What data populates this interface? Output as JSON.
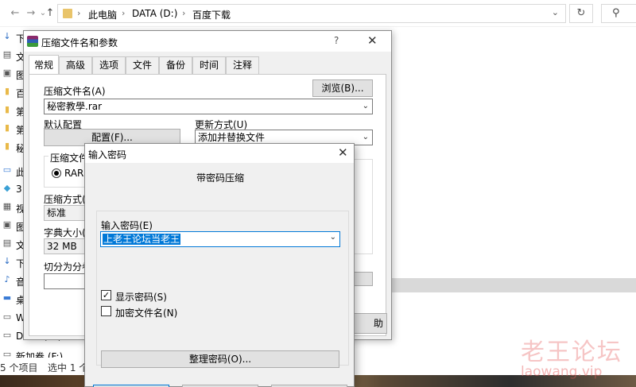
{
  "explorer": {
    "breadcrumb": [
      "此电脑",
      "DATA (D:)",
      "百度下载"
    ],
    "nav": {
      "back": "←",
      "forward": "→",
      "recent": "⌄",
      "up": "↑"
    },
    "refresh_icon": "↻",
    "search_icon": "⚲",
    "sidebar_items": [
      {
        "icon": "↓",
        "text": "下",
        "color": "#2b6cc4"
      },
      {
        "icon": "▤",
        "text": "文",
        "color": "#555"
      },
      {
        "icon": "▣",
        "text": "图",
        "color": "#555"
      },
      {
        "icon": "▮",
        "text": "百",
        "color": "#e9b949"
      },
      {
        "icon": "▮",
        "text": "第",
        "color": "#e9b949"
      },
      {
        "icon": "▮",
        "text": "第",
        "color": "#e9b949"
      },
      {
        "icon": "▮",
        "text": "秘",
        "color": "#e9b949"
      },
      {
        "icon": "▭",
        "text": "此",
        "color": "#3a7bd5"
      },
      {
        "icon": "◆",
        "text": "3",
        "color": "#3aa0d5"
      },
      {
        "icon": "▦",
        "text": "视",
        "color": "#555"
      },
      {
        "icon": "▣",
        "text": "图",
        "color": "#555"
      },
      {
        "icon": "▤",
        "text": "文",
        "color": "#555"
      },
      {
        "icon": "↓",
        "text": "下",
        "color": "#2b6cc4"
      },
      {
        "icon": "♪",
        "text": "音",
        "color": "#2b6cc4"
      },
      {
        "icon": "▬",
        "text": "桌",
        "color": "#3a7bd5"
      },
      {
        "icon": "▭",
        "text": "W",
        "color": "#555"
      },
      {
        "icon": "▭",
        "text": "DATA (D:)",
        "color": "#555"
      },
      {
        "icon": "▭",
        "text": "新加卷 (F:)",
        "color": "#555"
      }
    ],
    "status": {
      "count": "5 个项目",
      "selected": "选中 1 个"
    }
  },
  "archive_dialog": {
    "title": "压缩文件名和参数",
    "help": "?",
    "close": "✕",
    "tabs": [
      "常规",
      "高级",
      "选项",
      "文件",
      "备份",
      "时间",
      "注释"
    ],
    "active_tab": "常规",
    "archive_name_label": "压缩文件名(A)",
    "browse_button": "浏览(B)...",
    "archive_name_value": "秘密教學.rar",
    "default_profile_label": "默认配置",
    "profile_button": "配置(F)...",
    "update_mode_label": "更新方式(U)",
    "update_mode_value": "添加并替换文件",
    "format_group_label": "压缩文件",
    "format_rar": "RAR",
    "method_label": "压缩方式(",
    "method_value": "标准",
    "dict_label": "字典大小(",
    "dict_value": "32 MB",
    "split_label": "切分为分卷",
    "ok_partial": "助"
  },
  "password_dialog": {
    "title": "输入密码",
    "close": "✕",
    "heading": "带密码压缩",
    "enter_password_label": "输入密码(E)",
    "password_value": "上老王论坛当老王",
    "show_password_label": "显示密码(S)",
    "show_password_checked": true,
    "encrypt_names_label": "加密文件名(N)",
    "encrypt_names_checked": false,
    "organize_button": "整理密码(O)..."
  },
  "watermark": {
    "main": "老王论坛",
    "sub": "laowang.vip"
  }
}
